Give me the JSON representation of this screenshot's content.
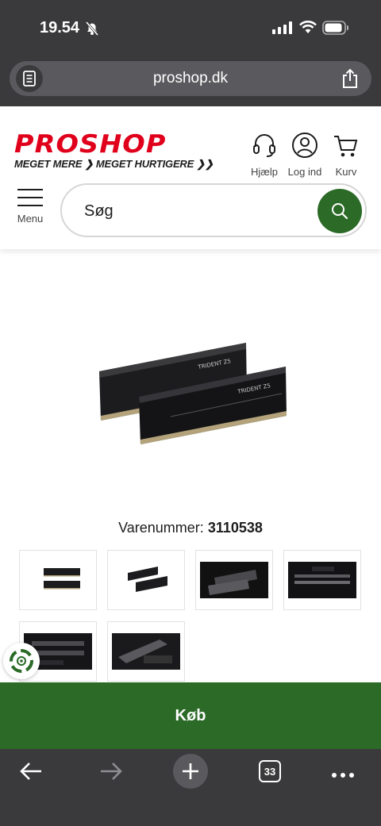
{
  "status_bar": {
    "time": "19.54"
  },
  "browser": {
    "url": "proshop.dk",
    "tab_count": "33"
  },
  "header": {
    "logo_word": "PROSHOP",
    "logo_tagline": "MEGET MERE ❯ MEGET HURTIGERE ❯❯",
    "help_label": "Hjælp",
    "login_label": "Log ind",
    "cart_label": "Kurv",
    "menu_label": "Menu",
    "search_placeholder": "Søg"
  },
  "product": {
    "sku_label": "Varenummer:",
    "sku_value": "3110538"
  },
  "buy_label": "Køb",
  "colors": {
    "brand_red": "#e0001b",
    "brand_green": "#2b6a27"
  }
}
